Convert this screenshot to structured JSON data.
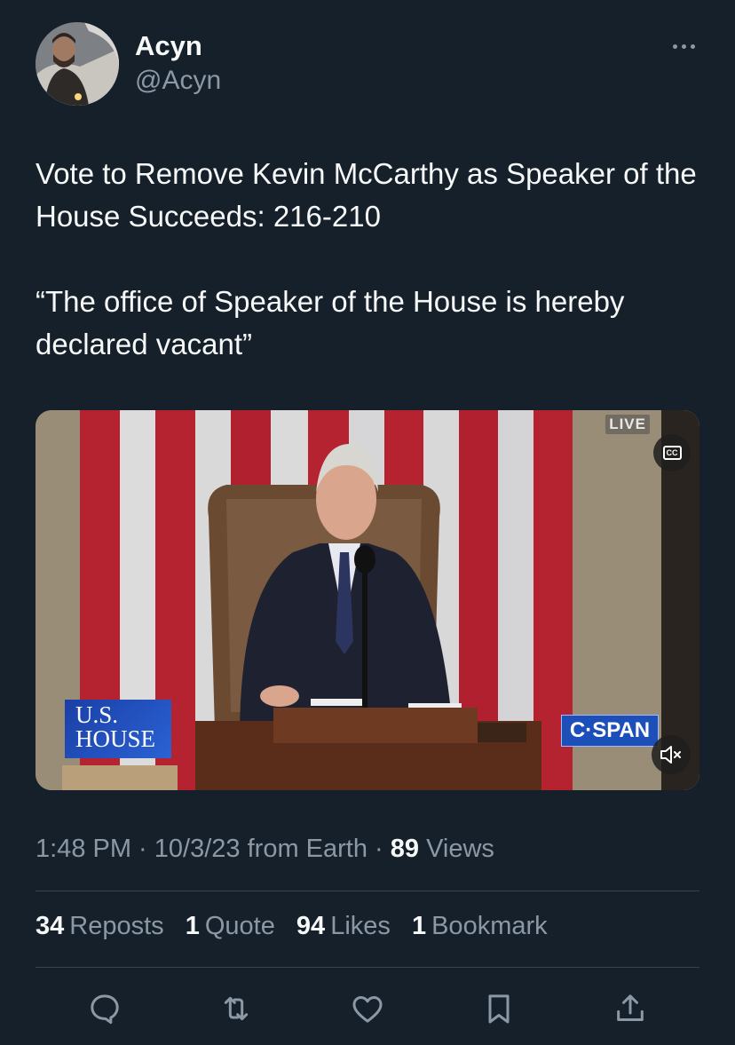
{
  "author": {
    "display_name": "Acyn",
    "handle": "@Acyn"
  },
  "tweet": {
    "line1": "Vote to Remove Kevin McCarthy as Speaker of the House Succeeds: 216-210",
    "line2": "“The office of Speaker of the House is hereby declared vacant”"
  },
  "video": {
    "live_label": "LIVE",
    "cc_label": "CC",
    "house_logo_line1": "U.S.",
    "house_logo_line2": "HOUSE",
    "network_logo": "C·SPAN"
  },
  "meta": {
    "time": "1:48 PM",
    "separator": " · ",
    "date": "10/3/23",
    "source": "from Earth",
    "views_count": "89",
    "views_label": "Views"
  },
  "stats": {
    "reposts_count": "34",
    "reposts_label": "Reposts",
    "quotes_count": "1",
    "quotes_label": "Quote",
    "likes_count": "94",
    "likes_label": "Likes",
    "bookmarks_count": "1",
    "bookmarks_label": "Bookmark"
  },
  "icons": {
    "more": "more-icon",
    "reply": "reply-icon",
    "repost": "repost-icon",
    "like": "heart-icon",
    "bookmark": "bookmark-icon",
    "share": "share-icon"
  },
  "colors": {
    "background": "#15202b",
    "primary_text": "#f7f9f9",
    "secondary_text": "#8b98a5",
    "divider": "#38444d"
  }
}
